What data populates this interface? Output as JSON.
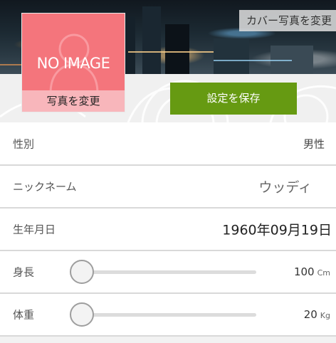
{
  "header": {
    "cover_button": "カバー写真を変更",
    "avatar_placeholder": "NO IMAGE",
    "change_photo_label": "写真を変更",
    "save_button": "設定を保存"
  },
  "colors": {
    "avatar_bg": "#f4757c",
    "save_button_bg": "#669a12"
  },
  "fields": {
    "gender": {
      "label": "性別",
      "value": "男性"
    },
    "nickname": {
      "label": "ニックネーム",
      "value": "ウッディ"
    },
    "birthday": {
      "label": "生年月日",
      "value": "1960年09月19日"
    },
    "height": {
      "label": "身長",
      "value": "100",
      "unit": "Cm",
      "slider_level": 0
    },
    "weight": {
      "label": "体重",
      "value": "20",
      "unit": "Kg",
      "slider_level": 0
    }
  }
}
